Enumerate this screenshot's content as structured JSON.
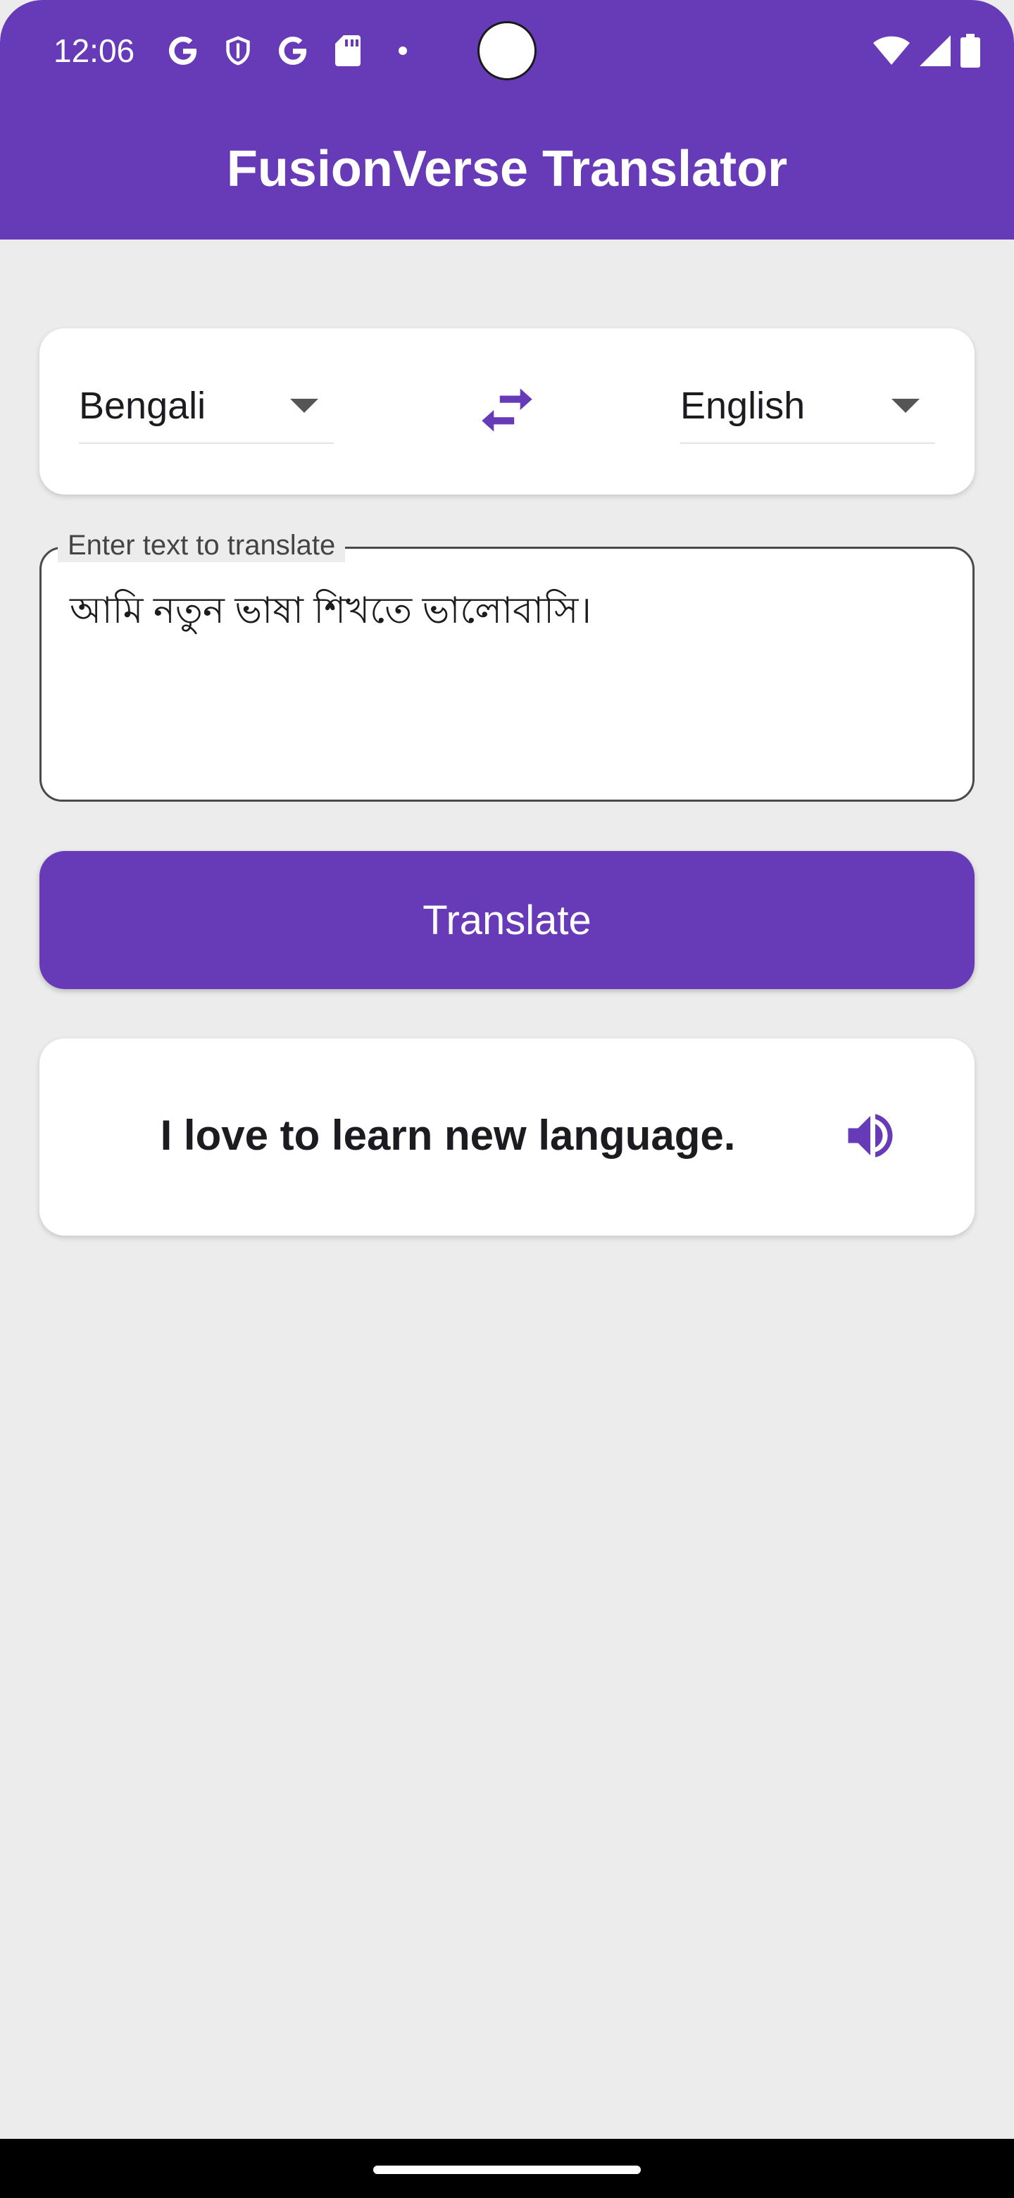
{
  "status_bar": {
    "time": "12:06",
    "left_icons": [
      "google-g-icon",
      "shield-icon",
      "google-g-icon",
      "sd-card-icon",
      "dot-icon"
    ],
    "right_icons": [
      "wifi-icon",
      "cellular-signal-icon",
      "battery-icon"
    ]
  },
  "app_bar": {
    "title": "FusionVerse Translator",
    "color": "#673ab7"
  },
  "languages": {
    "source": "Bengali",
    "target": "English",
    "swap_icon": "swap-horiz-icon"
  },
  "input": {
    "label": "Enter text to translate",
    "value": "আমি নতুন ভাষা শিখতে ভালোবাসি।"
  },
  "translate_button": {
    "label": "Translate"
  },
  "result": {
    "text": "I love to learn new language.",
    "speaker_icon": "volume-up-icon"
  },
  "colors": {
    "accent": "#673ab7",
    "background": "#ececec",
    "card": "#ffffff"
  }
}
